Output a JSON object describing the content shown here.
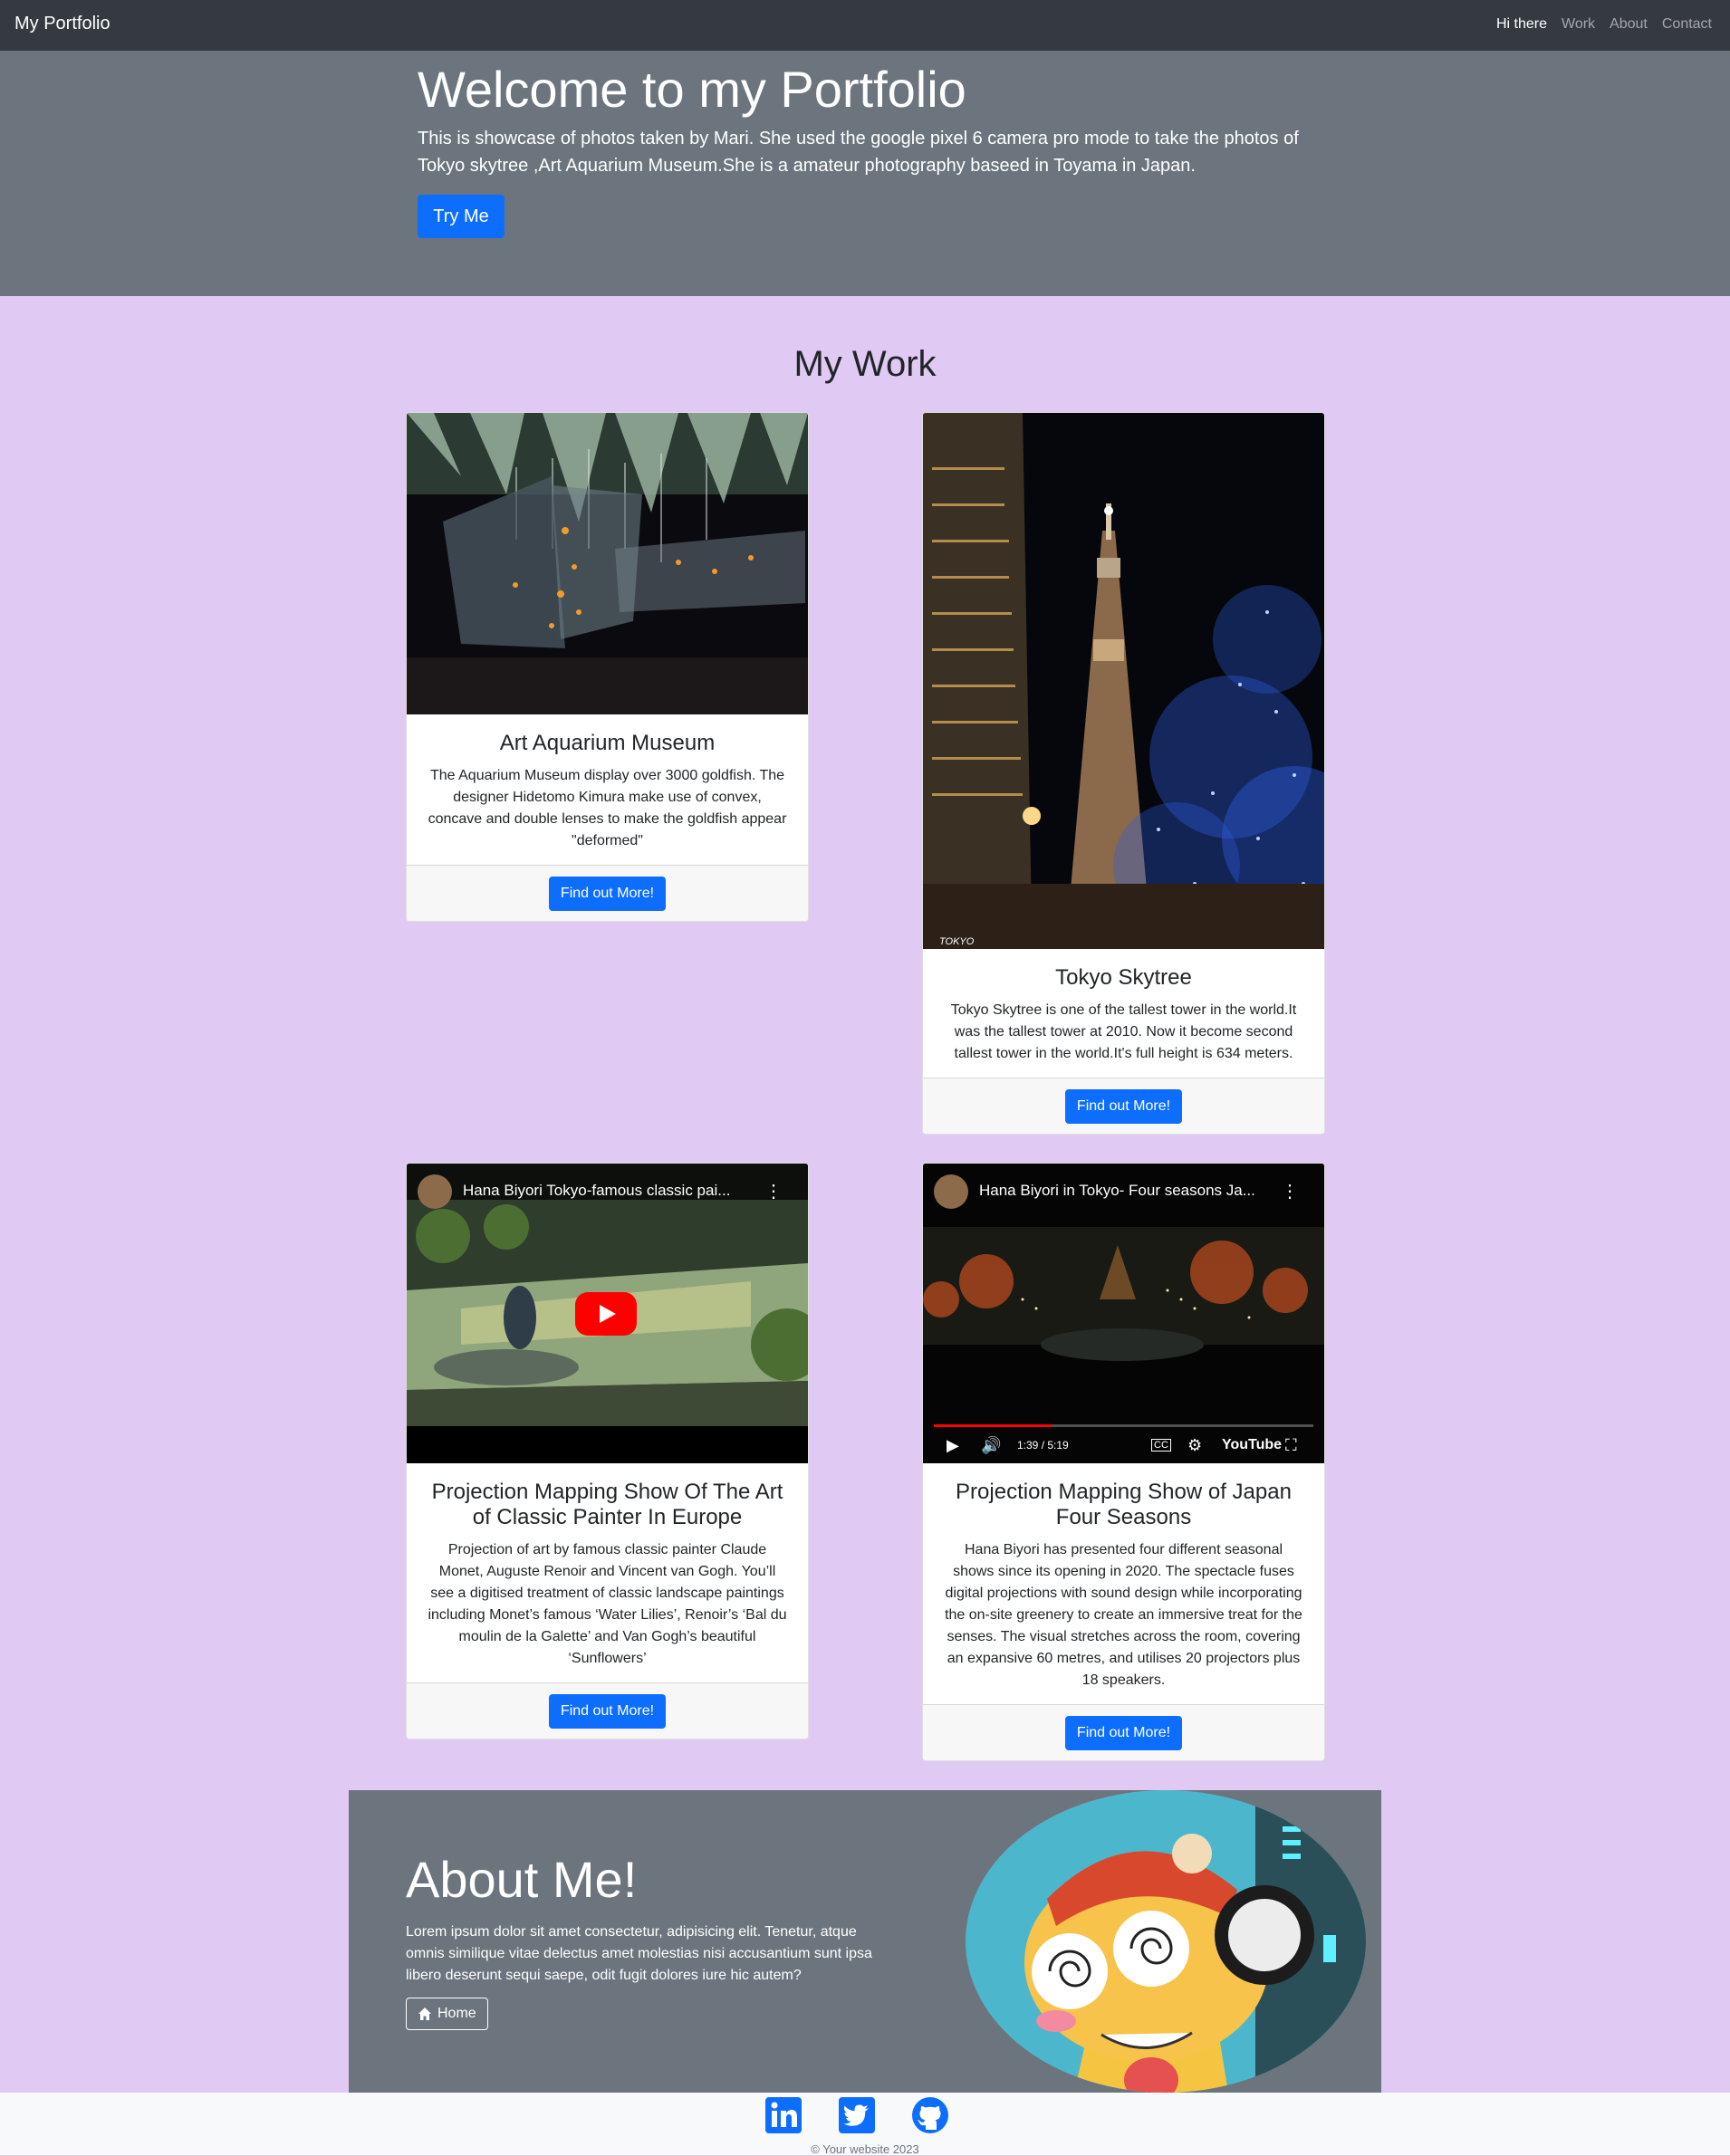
{
  "navbar": {
    "brand": "My Portfolio",
    "links": [
      "Hi there",
      "Work",
      "About",
      "Contact"
    ]
  },
  "hero": {
    "title": "Welcome to my Portfolio",
    "text": "This is showcase of photos taken by Mari. She used the google pixel 6 camera pro mode to take the photos of Tokyo skytree ,Art Aquarium Museum.She is a amateur photography baseed in Toyama in Japan.",
    "button": "Try Me"
  },
  "work": {
    "title": "My Work",
    "cards": [
      {
        "title": "Art Aquarium Museum",
        "text": "The Aquarium Museum display over 3000 goldfish. The designer Hidetomo Kimura make use of convex, concave and double lenses to make the goldfish appear \"deformed\"",
        "button": "Find out More!"
      },
      {
        "title": "Tokyo Skytree",
        "text": "Tokyo Skytree is one of the tallest tower in the world.It was the tallest tower at 2010. Now it become second tallest tower in the world.It's full height is 634 meters.",
        "button": "Find out More!",
        "watermark": "TOKYO"
      },
      {
        "title": "Projection Mapping Show Of The Art of Classic Painter In Europe",
        "text": "Projection of art by famous classic painter Claude Monet, Auguste Renoir and Vincent van Gogh. You’ll see a digitised treatment of classic landscape paintings including Monet’s famous ‘Water Lilies’, Renoir’s ‘Bal du moulin de la Galette’ and Van Gogh’s beautiful ‘Sunflowers’",
        "button": "Find out More!",
        "video_title": "Hana Biyori Tokyo-famous classic pai..."
      },
      {
        "title": "Projection Mapping Show of Japan Four Seasons",
        "text": "Hana Biyori has presented four different seasonal shows since its opening in 2020. The spectacle fuses digital projections with sound design while incorporating the on-site greenery to create an immersive treat for the senses. The visual stretches across the room, covering an expansive 60 metres, and utilises 20 projectors plus 18 speakers.",
        "button": "Find out More!",
        "video_title": "Hana Biyori in Tokyo- Four seasons Ja...",
        "video_time": "1:39 / 5:19",
        "video_progress": 0.31,
        "youtube_label": "YouTube"
      }
    ]
  },
  "about": {
    "title": "About Me!",
    "text": "Lorem ipsum dolor sit amet consectetur, adipisicing elit. Tenetur, atque omnis similique vitae delectus amet molestias nisi accusantium sunt ipsa libero deserunt sequi saepe, odit fugit dolores iure hic autem?",
    "button": "Home"
  },
  "footer": {
    "social_icons": [
      "linkedin-icon",
      "twitter-icon",
      "github-icon"
    ],
    "copyright": "© Your website 2023"
  },
  "colors": {
    "navbar": "#343a40",
    "hero": "#6c757d",
    "page_bg": "#e0c9f2",
    "primary": "#0d6efd",
    "social": "#0d6efd"
  }
}
